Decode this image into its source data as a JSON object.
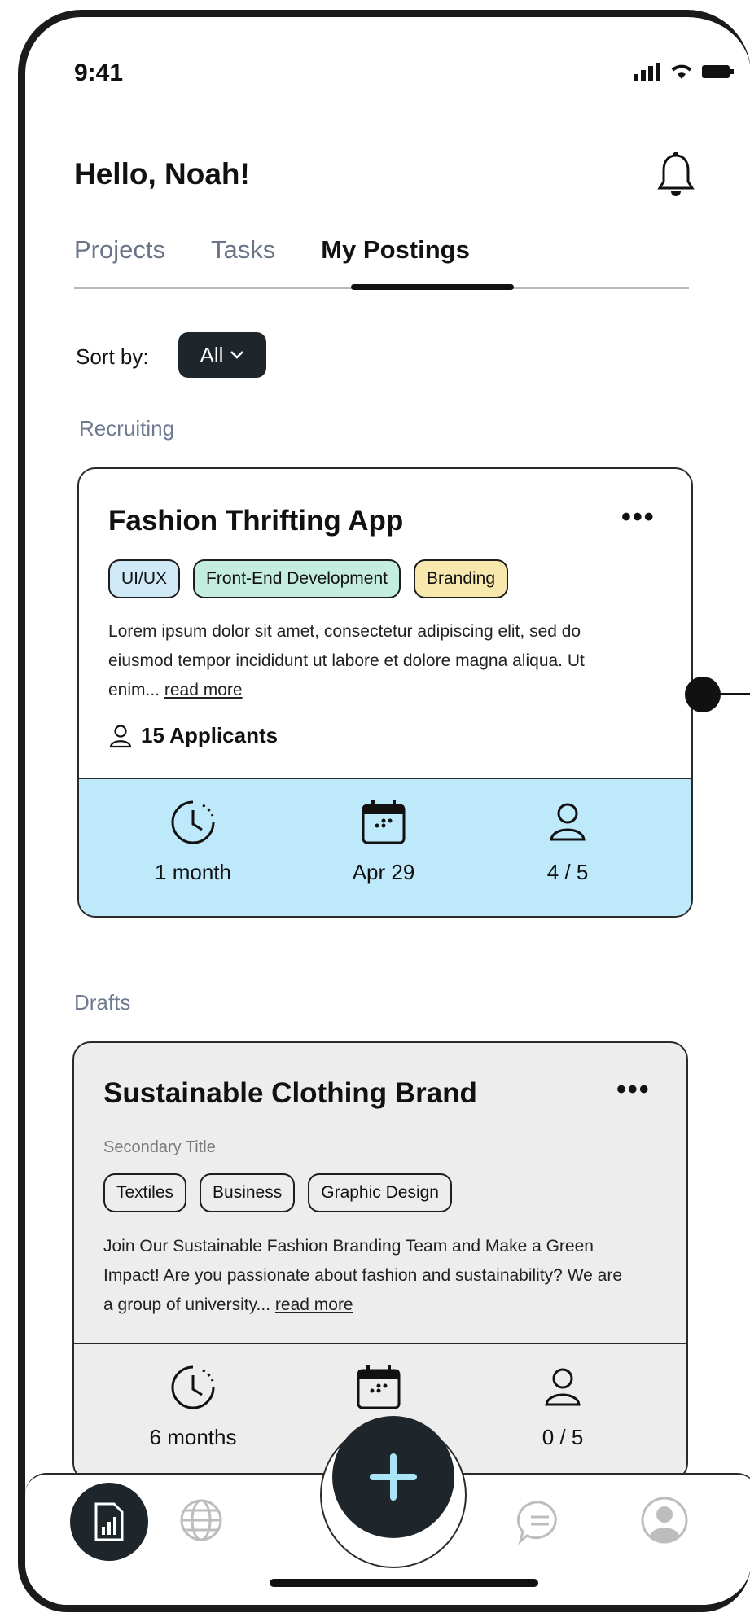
{
  "status_bar": {
    "time": "9:41"
  },
  "header": {
    "greeting": "Hello, Noah!"
  },
  "tabs": [
    {
      "label": "Projects",
      "active": false
    },
    {
      "label": "Tasks",
      "active": false
    },
    {
      "label": "My Postings",
      "active": true
    }
  ],
  "sort": {
    "label": "Sort by:",
    "value": "All"
  },
  "recruiting": {
    "section_label": "Recruiting",
    "card": {
      "title": "Fashion Thrifting App",
      "tags": [
        {
          "label": "UI/UX",
          "color": "#cfe9f6"
        },
        {
          "label": "Front-End Development",
          "color": "#c4ecdf"
        },
        {
          "label": "Branding",
          "color": "#f9e8ad"
        }
      ],
      "description": "Lorem ipsum dolor sit amet, consectetur adipiscing elit, sed do eiusmod tempor incididunt ut labore et dolore magna aliqua. Ut enim...",
      "read_more": "read more",
      "applicants": "15 Applicants",
      "footer_color": "#bde9fa",
      "stats": {
        "duration": "1 month",
        "date": "Apr 29",
        "members": "4 / 5"
      }
    }
  },
  "drafts": {
    "section_label": "Drafts",
    "card": {
      "title": "Sustainable Clothing Brand",
      "subtitle": "Secondary Title",
      "tags": [
        {
          "label": "Textiles"
        },
        {
          "label": "Business"
        },
        {
          "label": "Graphic Design"
        }
      ],
      "description": "Join Our Sustainable Fashion Branding Team and Make a Green Impact! Are you passionate about fashion and sustainability? We are a group of university...",
      "read_more": "read more",
      "background": "#ededee",
      "stats": {
        "duration": "6 months",
        "members": "0 / 5"
      }
    }
  },
  "bottom_nav": {
    "items": [
      "report-icon",
      "globe-icon",
      "add-icon",
      "chat-icon",
      "profile-icon"
    ]
  }
}
